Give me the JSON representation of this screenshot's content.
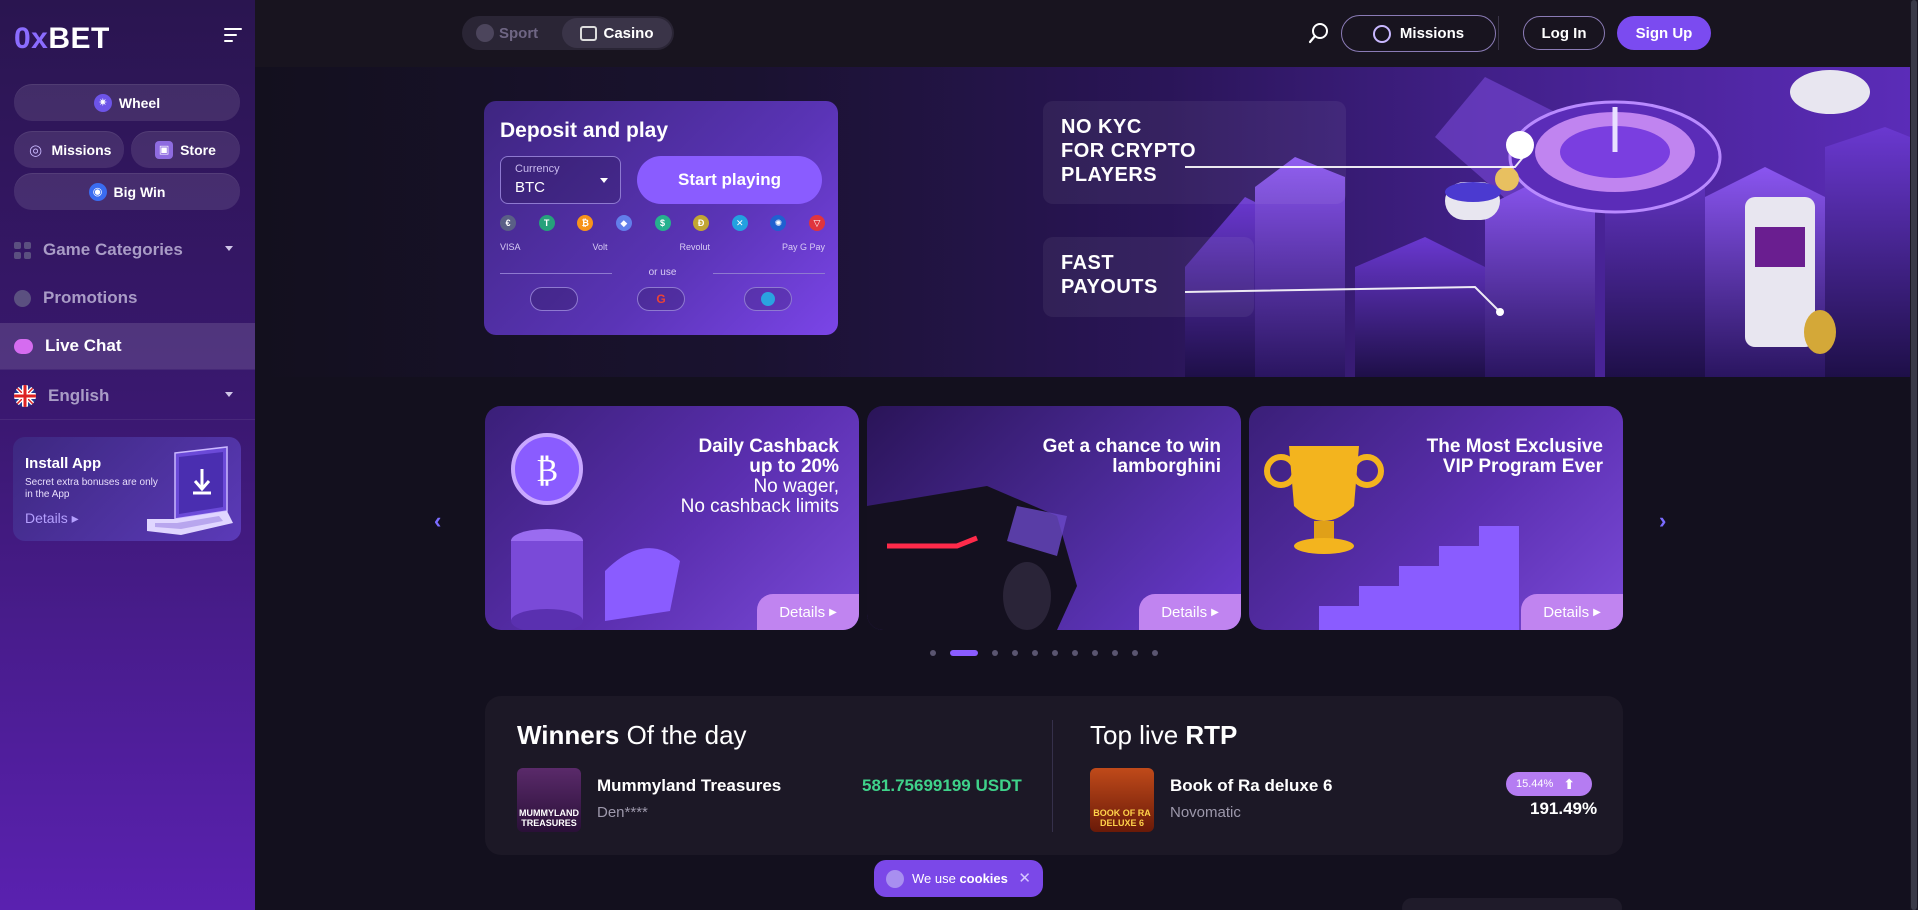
{
  "brand": {
    "logo_prefix": "0x",
    "logo_suffix": "BET"
  },
  "sidebar": {
    "quick": {
      "wheel": "Wheel",
      "missions": "Missions",
      "store": "Store",
      "bigwin": "Big Win"
    },
    "nav": [
      {
        "label": "Game Categories"
      },
      {
        "label": "Promotions"
      },
      {
        "label": "Live Chat"
      },
      {
        "label": "English"
      }
    ],
    "install": {
      "title": "Install App",
      "subtitle": "Secret extra bonuses are only in the App",
      "details": "Details"
    }
  },
  "topbar": {
    "sport": "Sport",
    "casino": "Casino",
    "missions": "Missions",
    "login": "Log In",
    "signup": "Sign Up"
  },
  "deposit": {
    "title": "Deposit and play",
    "currency_label": "Currency",
    "currency_value": "BTC",
    "start": "Start playing",
    "payments": [
      "VISA",
      "Volt",
      "Revolut",
      "Pay G Pay"
    ],
    "or_use": "or use"
  },
  "hero": {
    "promo1": [
      "NO KYC",
      "FOR CRYPTO",
      "PLAYERS"
    ],
    "promo2": [
      "FAST",
      "PAYOUTS"
    ]
  },
  "cards": [
    {
      "title1": "Daily Cashback",
      "title2": "up to 20%",
      "sub1": "No wager,",
      "sub2": "No cashback limits",
      "details": "Details"
    },
    {
      "title1": "Get a chance to win",
      "title2": "lamborghini",
      "details": "Details"
    },
    {
      "title1": "The Most Exclusive",
      "title2": "VIP Program Ever",
      "details": "Details"
    }
  ],
  "winners": {
    "title_bold": "Winners",
    "title_rest": " Of the day",
    "game": "Mummyland Treasures",
    "user": "Den****",
    "amount": "581.75699199 USDT",
    "thumb_text": "MUMMYLAND TREASURES"
  },
  "rtp": {
    "title_rest": "Top live ",
    "title_bold": "RTP",
    "game": "Book of Ra deluxe 6",
    "provider": "Novomatic",
    "badge": "15.44%",
    "value": "191.49%",
    "thumb_text": "BOOK OF RA DELUXE 6"
  },
  "cookie": {
    "prefix": "We use ",
    "bold": "cookies"
  },
  "colors": {
    "accent": "#7b4bf0",
    "green": "#3fd28a",
    "details": "#c084f0"
  }
}
